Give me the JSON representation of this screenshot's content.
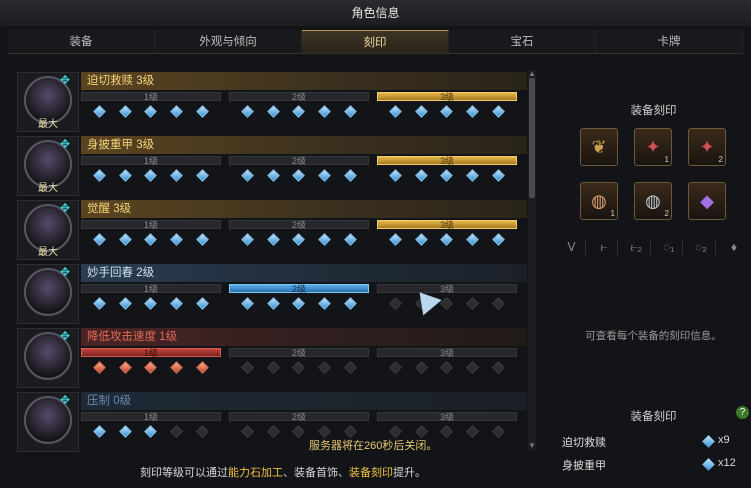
{
  "window": {
    "title": "角色信息"
  },
  "tabs": [
    {
      "label": "装备"
    },
    {
      "label": "外观与倾向"
    },
    {
      "label": "刻印",
      "active": true
    },
    {
      "label": "宝石"
    },
    {
      "label": "卡牌"
    }
  ],
  "engravings": [
    {
      "name": "迫切救赎 3级",
      "style": "gold",
      "max_label": "最大",
      "levels": [
        "1级",
        "2级",
        "3级"
      ],
      "active_level": 3,
      "gems": [
        [
          5,
          "b"
        ],
        [
          5,
          "b"
        ],
        [
          5,
          "b"
        ]
      ]
    },
    {
      "name": "身披重甲 3级",
      "style": "gold",
      "max_label": "最大",
      "levels": [
        "1级",
        "2级",
        "3级"
      ],
      "active_level": 3,
      "gems": [
        [
          5,
          "b"
        ],
        [
          5,
          "b"
        ],
        [
          5,
          "b"
        ]
      ]
    },
    {
      "name": "觉醒 3级",
      "style": "gold",
      "max_label": "最大",
      "levels": [
        "1级",
        "2级",
        "3级"
      ],
      "active_level": 3,
      "gems": [
        [
          5,
          "b"
        ],
        [
          5,
          "b"
        ],
        [
          5,
          "b"
        ]
      ]
    },
    {
      "name": "妙手回春 2级",
      "style": "blue",
      "max_label": "",
      "levels": [
        "1级",
        "2级",
        "3级"
      ],
      "active_level": 2,
      "gems": [
        [
          5,
          "b"
        ],
        [
          5,
          "b"
        ],
        [
          0,
          "b"
        ]
      ]
    },
    {
      "name": "降低攻击速度 1级",
      "style": "red",
      "max_label": "",
      "levels": [
        "1级",
        "2级",
        "3级"
      ],
      "active_level": 1,
      "gems": [
        [
          5,
          "r"
        ],
        [
          0,
          "b"
        ],
        [
          0,
          "b"
        ]
      ]
    },
    {
      "name": "压制 0级",
      "style": "dim",
      "max_label": "",
      "levels": [
        "1级",
        "2级",
        "3级"
      ],
      "active_level": 0,
      "gems": [
        [
          3,
          "b"
        ],
        [
          0,
          "b"
        ],
        [
          0,
          "b"
        ]
      ]
    }
  ],
  "side_panel": {
    "equip_title": "装备刻印",
    "slots": [
      {
        "icon": "necklace",
        "num": ""
      },
      {
        "icon": "earring",
        "num": "1"
      },
      {
        "icon": "earring",
        "num": "2"
      },
      {
        "icon": "ring",
        "num": "1"
      },
      {
        "icon": "ring",
        "num": "2"
      },
      {
        "icon": "stone",
        "num": ""
      }
    ],
    "slot_labels": [
      "ⴸ",
      "⥼",
      "⥼₂",
      "◌₁",
      "◌₂",
      "♦"
    ],
    "hint": "可查看每个装备的刻印信息。",
    "summary_title": "装备刻印",
    "help": "?",
    "summary": [
      {
        "name": "迫切救赎",
        "count": "x9"
      },
      {
        "name": "身披重甲",
        "count": "x12"
      }
    ]
  },
  "notice": "服务器将在260秒后关闭。",
  "footer": {
    "pre": "刻印等级可以通过",
    "hl1": "能力石加工",
    "sep1": "、装备首饰、",
    "hl2": "装备刻印",
    "post": "提升。"
  }
}
